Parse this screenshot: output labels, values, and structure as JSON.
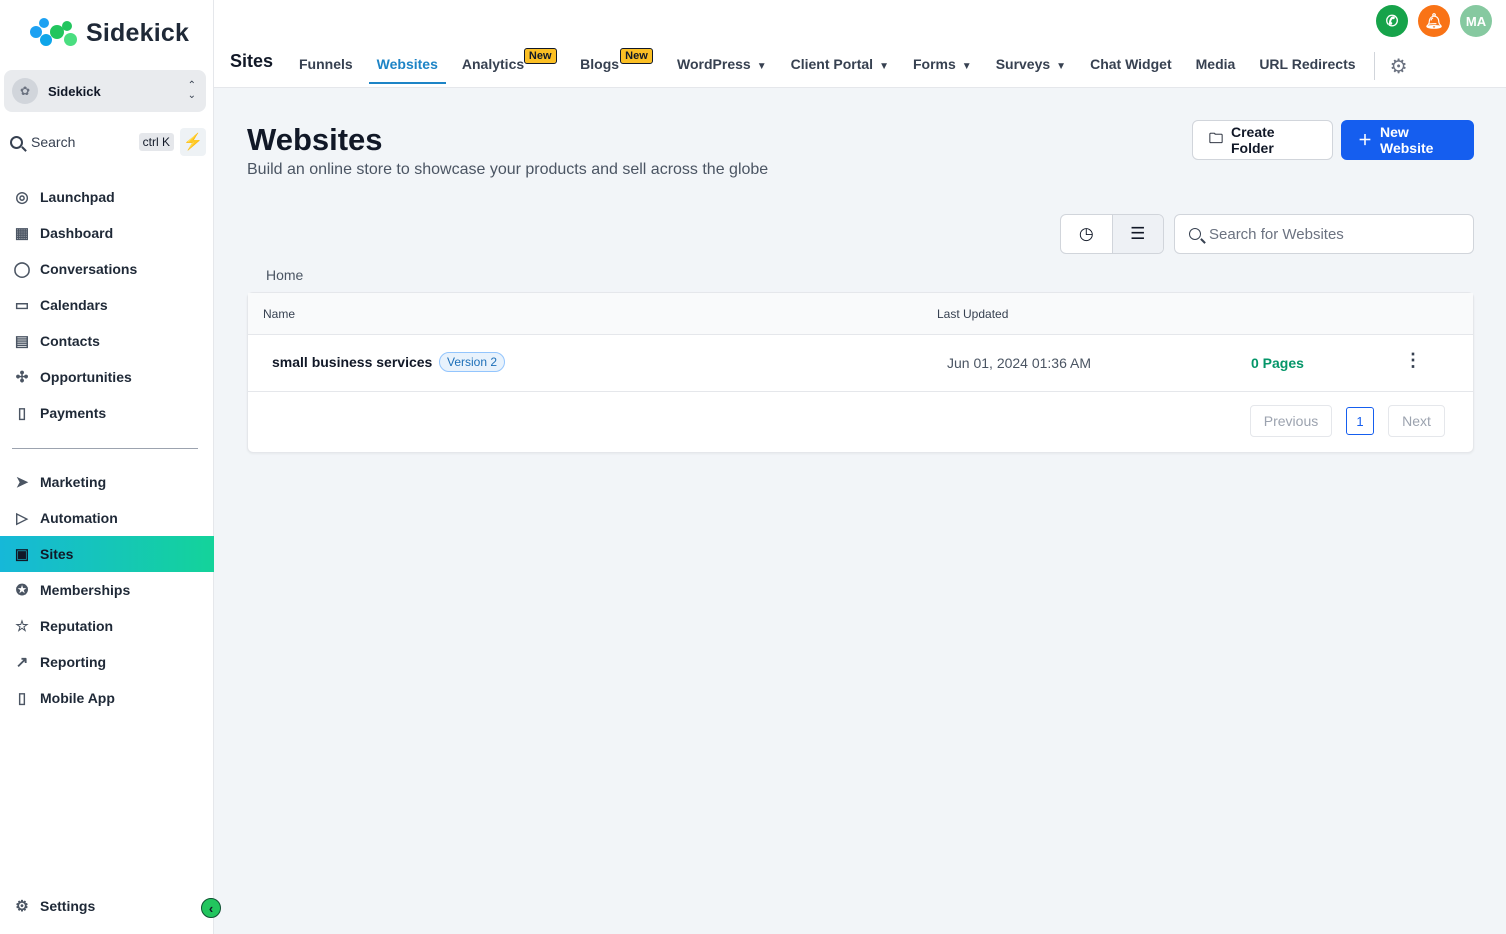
{
  "app": {
    "logo_text": "Sidekick",
    "brand_colors": [
      "#1da1f2",
      "#22c55e"
    ]
  },
  "account": {
    "name": "Sidekick"
  },
  "sidebar_search": {
    "label": "Search",
    "shortcut": "ctrl K"
  },
  "sidebar": {
    "primary": [
      {
        "label": "Launchpad",
        "icon": "launchpad-icon"
      },
      {
        "label": "Dashboard",
        "icon": "dashboard-icon"
      },
      {
        "label": "Conversations",
        "icon": "chat-bubble-icon"
      },
      {
        "label": "Calendars",
        "icon": "calendar-icon"
      },
      {
        "label": "Contacts",
        "icon": "contacts-icon"
      },
      {
        "label": "Opportunities",
        "icon": "opportunities-icon"
      },
      {
        "label": "Payments",
        "icon": "payments-icon"
      }
    ],
    "secondary": [
      {
        "label": "Marketing",
        "icon": "send-icon"
      },
      {
        "label": "Automation",
        "icon": "automation-icon"
      },
      {
        "label": "Sites",
        "icon": "sites-icon",
        "active": true
      },
      {
        "label": "Memberships",
        "icon": "award-icon"
      },
      {
        "label": "Reputation",
        "icon": "star-icon"
      },
      {
        "label": "Reporting",
        "icon": "trend-icon"
      },
      {
        "label": "Mobile App",
        "icon": "mobile-icon"
      }
    ],
    "settings_label": "Settings"
  },
  "topbar": {
    "section_title": "Sites",
    "tabs": [
      {
        "label": "Funnels"
      },
      {
        "label": "Websites",
        "active": true
      },
      {
        "label": "Analytics",
        "badge": "New"
      },
      {
        "label": "Blogs",
        "badge": "New"
      },
      {
        "label": "WordPress",
        "dropdown": true
      },
      {
        "label": "Client Portal",
        "dropdown": true
      },
      {
        "label": "Forms",
        "dropdown": true
      },
      {
        "label": "Surveys",
        "dropdown": true
      },
      {
        "label": "Chat Widget"
      },
      {
        "label": "Media"
      },
      {
        "label": "URL Redirects"
      }
    ],
    "user_initials": "MA",
    "colors": {
      "phone": "#16a34a",
      "bell": "#f97316",
      "avatar": "#86c9a0"
    }
  },
  "main": {
    "title": "Websites",
    "subtitle": "Build an online store to showcase your products and sell across the globe",
    "create_folder_label": "Create Folder",
    "new_website_label": "New Website",
    "search_placeholder": "Search for Websites",
    "breadcrumb": "Home",
    "table": {
      "columns": {
        "name": "Name",
        "last_updated": "Last Updated"
      },
      "rows": [
        {
          "name": "small business services",
          "version": "Version 2",
          "last_updated": "Jun 01, 2024 01:36 AM",
          "pages": "0 Pages"
        }
      ]
    },
    "pagination": {
      "previous": "Previous",
      "current": "1",
      "next": "Next"
    }
  }
}
